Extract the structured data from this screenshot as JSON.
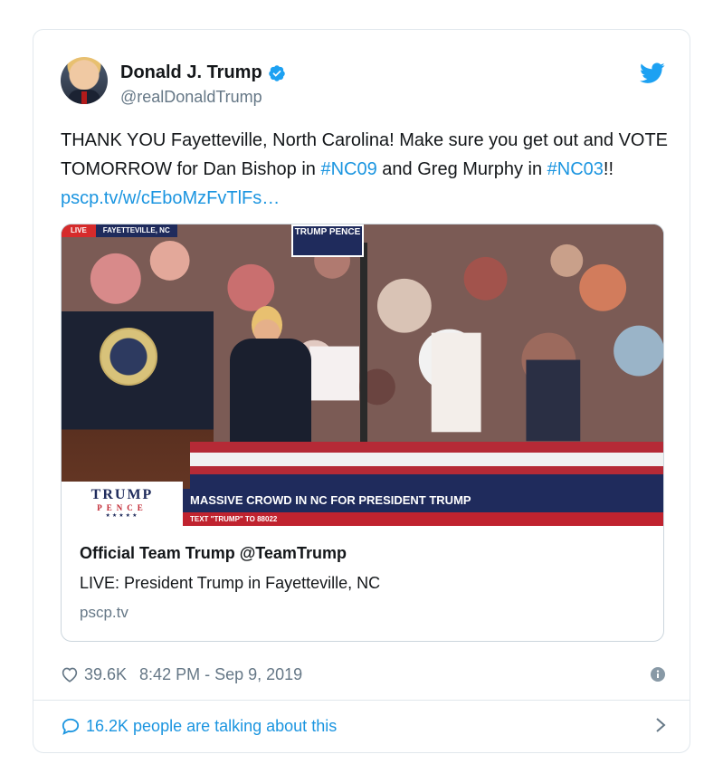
{
  "author": {
    "name": "Donald J. Trump",
    "handle": "@realDonaldTrump"
  },
  "tweet": {
    "segments": [
      {
        "text": "THANK YOU Fayetteville, North Carolina! Make sure you get out and VOTE TOMORROW for Dan Bishop in ",
        "link": false
      },
      {
        "text": "#NC09",
        "link": true
      },
      {
        "text": " and Greg Murphy in ",
        "link": false
      },
      {
        "text": "#NC03",
        "link": true
      },
      {
        "text": "!! ",
        "link": false
      },
      {
        "text": "pscp.tv/w/cEboMzFvTlFs…",
        "link": true
      }
    ]
  },
  "media": {
    "live_label": "LIVE",
    "location_label": "FAYETTEVILLE, NC",
    "sign_text": "TRUMP PENCE",
    "lower_third": {
      "logo_top": "TRUMP",
      "logo_middle": "PENCE",
      "logo_stars": "★★★★★",
      "headline": "MASSIVE CROWD IN NC FOR PRESIDENT TRUMP",
      "subline": "TEXT \"TRUMP\" TO 88022"
    }
  },
  "link_card": {
    "title": "Official Team Trump @TeamTrump",
    "description": "LIVE: President Trump in Fayetteville, NC",
    "domain": "pscp.tv"
  },
  "meta": {
    "likes": "39.6K",
    "timestamp": "8:42 PM - Sep 9, 2019"
  },
  "footer": {
    "talking": "16.2K people are talking about this"
  },
  "colors": {
    "link": "#1b95e0",
    "text": "#14171a",
    "muted": "#657786",
    "border": "#e1e8ed",
    "navy": "#1f2b5c",
    "red": "#c0232f"
  },
  "icons": [
    "verified-badge-icon",
    "twitter-bird-icon",
    "heart-icon",
    "info-icon",
    "speech-bubble-icon",
    "chevron-right-icon"
  ]
}
